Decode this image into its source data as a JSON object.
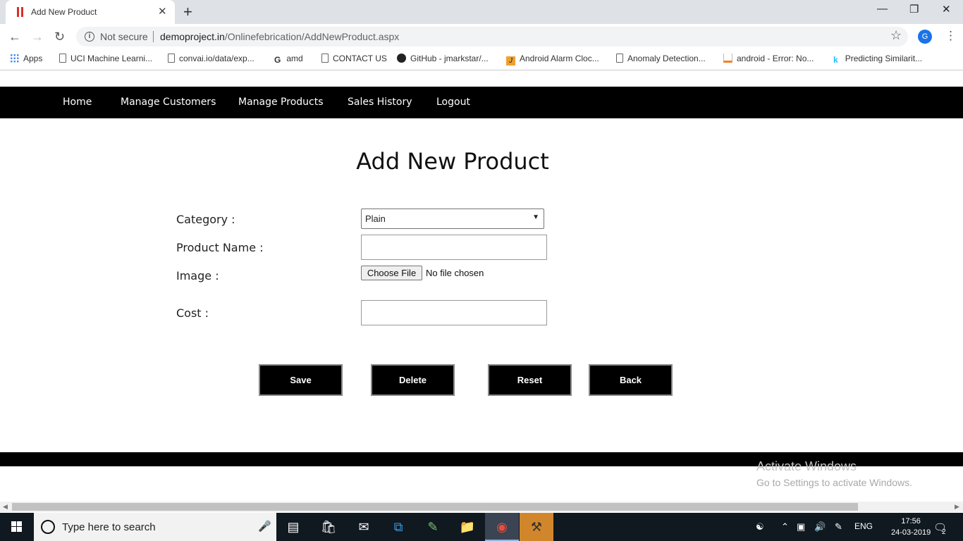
{
  "browser": {
    "tab_title": "Add New Product",
    "close_tab_glyph": "✕",
    "new_tab_glyph": "+",
    "security_label": "Not secure",
    "url_host": "demoproject.in",
    "url_path": "/Onlinefebrication/AddNewProduct.aspx",
    "profile_initial": "G",
    "bookmarks": [
      {
        "label": "Apps",
        "icon": "apps-icon"
      },
      {
        "label": "UCI Machine Learni...",
        "icon": "page-icon"
      },
      {
        "label": "convai.io/data/exp...",
        "icon": "page-icon"
      },
      {
        "label": "amd",
        "icon": "g-logo-icon"
      },
      {
        "label": "CONTACT US",
        "icon": "page-icon"
      },
      {
        "label": "GitHub - jmarkstar/...",
        "icon": "github-icon"
      },
      {
        "label": "Android Alarm Cloc...",
        "icon": "j-logo-icon"
      },
      {
        "label": "Anomaly Detection...",
        "icon": "page-icon"
      },
      {
        "label": "android - Error: No...",
        "icon": "stackoverflow-icon"
      },
      {
        "label": "Predicting Similarit...",
        "icon": "k-logo-icon"
      }
    ]
  },
  "nav": {
    "home": "Home",
    "customers": "Manage Customers",
    "products": "Manage Products",
    "sales": "Sales History",
    "logout": "Logout"
  },
  "form": {
    "title": "Add New Product",
    "category_label": "Category :",
    "category_value": "Plain",
    "product_name_label": "Product Name :",
    "product_name_value": "",
    "image_label": "Image :",
    "file_button": "Choose File",
    "file_status": "No file chosen",
    "cost_label": "Cost :",
    "cost_value": ""
  },
  "buttons": {
    "save": "Save",
    "delete": "Delete",
    "reset": "Reset",
    "back": "Back"
  },
  "watermark": {
    "line1": "Activate Windows",
    "line2": "Go to Settings to activate Windows."
  },
  "taskbar": {
    "search_placeholder": "Type here to search",
    "language": "ENG",
    "time": "17:56",
    "date": "24-03-2019",
    "notification_count": "2"
  },
  "colors": {
    "nav_bg": "#000000",
    "button_bg": "#000000",
    "taskbar_bg": "#101820",
    "accent_blue": "#1a73e8"
  }
}
